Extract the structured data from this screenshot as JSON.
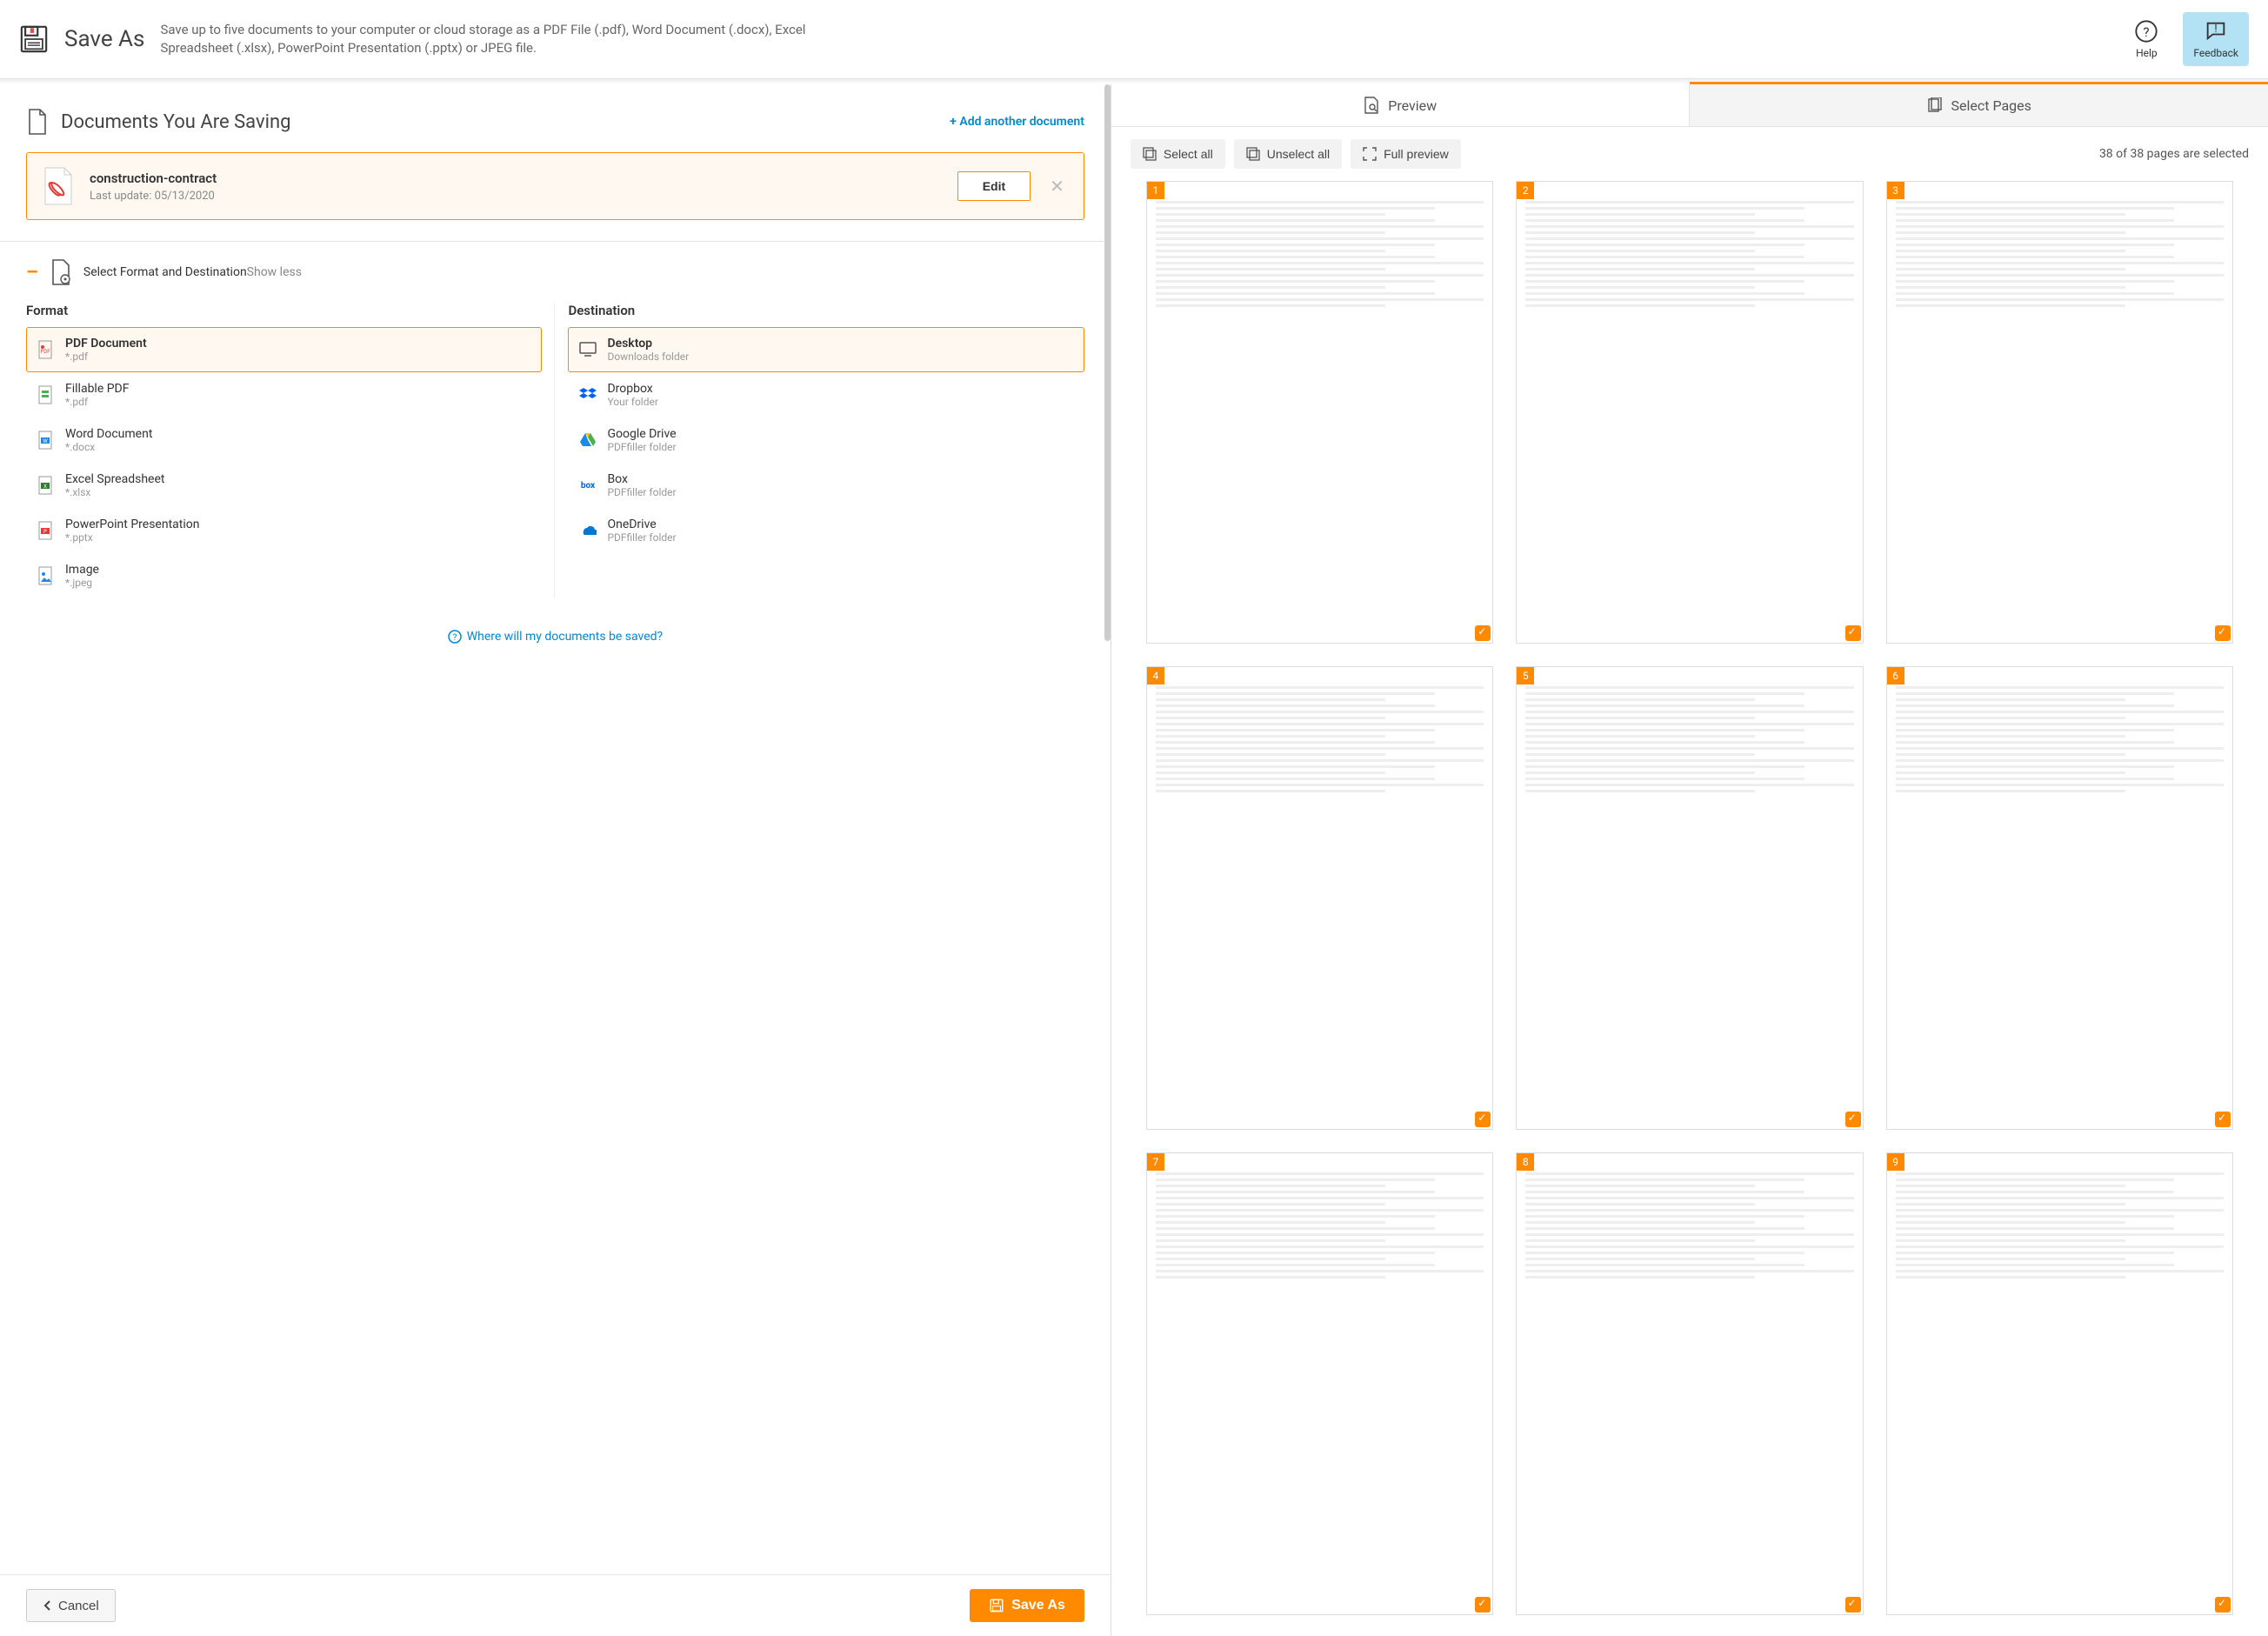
{
  "header": {
    "title": "Save As",
    "description": "Save up to five documents to your computer or cloud storage as a PDF File (.pdf), Word Document (.docx), Excel Spreadsheet (.xlsx), PowerPoint Presentation (.pptx) or JPEG file.",
    "help_label": "Help",
    "feedback_label": "Feedback"
  },
  "documents_section": {
    "title": "Documents You Are Saving",
    "add_link": "+ Add another document",
    "document": {
      "name": "construction-contract",
      "last_update": "Last update: 05/13/2020",
      "edit_label": "Edit"
    }
  },
  "format_section": {
    "title": "Select Format and Destination",
    "show_less": "Show less",
    "format_label": "Format",
    "destination_label": "Destination",
    "formats": [
      {
        "title": "PDF Document",
        "sub": "*.pdf",
        "selected": true,
        "icon": "pdf"
      },
      {
        "title": "Fillable PDF",
        "sub": "*.pdf",
        "icon": "fillable"
      },
      {
        "title": "Word Document",
        "sub": "*.docx",
        "icon": "word"
      },
      {
        "title": "Excel Spreadsheet",
        "sub": "*.xlsx",
        "icon": "excel"
      },
      {
        "title": "PowerPoint Presentation",
        "sub": "*.pptx",
        "icon": "ppt"
      },
      {
        "title": "Image",
        "sub": "*.jpeg",
        "icon": "image"
      }
    ],
    "destinations": [
      {
        "title": "Desktop",
        "sub": "Downloads folder",
        "selected": true,
        "icon": "desktop"
      },
      {
        "title": "Dropbox",
        "sub": "Your folder",
        "icon": "dropbox"
      },
      {
        "title": "Google Drive",
        "sub": "PDFfiller folder",
        "icon": "gdrive"
      },
      {
        "title": "Box",
        "sub": "PDFfiller folder",
        "icon": "box"
      },
      {
        "title": "OneDrive",
        "sub": "PDFfiller folder",
        "icon": "onedrive"
      }
    ],
    "where_link": "Where will my documents be saved?"
  },
  "footer": {
    "cancel": "Cancel",
    "save_as": "Save As"
  },
  "preview": {
    "tab_preview": "Preview",
    "tab_select": "Select Pages",
    "select_all": "Select all",
    "unselect_all": "Unselect all",
    "full_preview": "Full preview",
    "selected_text": "38 of 38 pages are selected",
    "pages": [
      1,
      2,
      3,
      4,
      5,
      6,
      7,
      8,
      9
    ]
  }
}
